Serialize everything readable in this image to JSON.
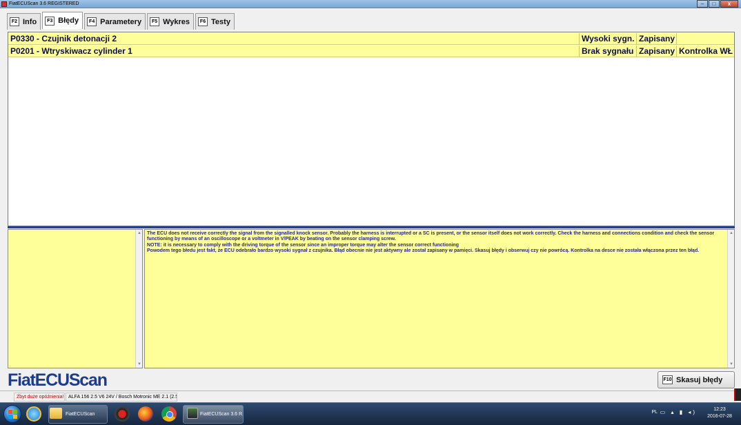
{
  "window": {
    "title": "FiatECUScan 3.6 REGISTERED",
    "controls": {
      "minimize": "–",
      "maximize": "□",
      "close": "x"
    }
  },
  "tabs": [
    {
      "key": "F2",
      "label": "Info",
      "active": false
    },
    {
      "key": "F3",
      "label": "Błędy",
      "active": true
    },
    {
      "key": "F4",
      "label": "Parametery",
      "active": false
    },
    {
      "key": "F5",
      "label": "Wykres",
      "active": false
    },
    {
      "key": "F6",
      "label": "Testy",
      "active": false
    }
  ],
  "errors": [
    {
      "code": "P0330 - Czujnik detonacji 2",
      "signal": "Wysoki sygn.",
      "status": "Zapisany",
      "lamp": ""
    },
    {
      "code": "P0201 - Wtryskiwacz cylinder 1",
      "signal": "Brak sygnału",
      "status": "Zapisany",
      "lamp": "Kontrolka WŁ"
    }
  ],
  "description": {
    "line1": "The ECU does not receive correctly the signal from the signalled knock sensor. Probably the harness is interrupted or a SC is present, or the sensor itself does not work correctly. Check the harness and connections condition and check the sensor functioning by means of an oscilloscope or a voltmeter in V/PEAK by beating on the sensor clamping screw.",
    "line2": "NOTE: it is necessary to comply with the driving torque of the sensor since an improper torque may alter the sensor correct functioning",
    "line3": "Powodem tego błedu jest fakt, że ECU odebrało bardzo wysoki sygnał z czujnika. Błąd obecnie nie jest aktywny ale został zapisany w pamięci. Skasuj błędy i obserwuj czy nie powrócą. Kontrolka na desce nie została włączona przez ten błąd."
  },
  "logo": "FiatECUScan",
  "clear_button": {
    "key": "F10",
    "label": "Skasuj błędy"
  },
  "statusbar": {
    "warning": "Zbyt duże opóźnienia!!",
    "ecu": "ALFA 156 2.5 V6 24V / Bosch Motronic ME 2.1 (2.5 V6)"
  },
  "taskbar": {
    "tasks": [
      {
        "label": "FiatECUScan"
      },
      {
        "label": "FiatECUScan 3.6 R..."
      }
    ],
    "language": "PL",
    "time": "12:23",
    "date": "2016-07-28"
  }
}
